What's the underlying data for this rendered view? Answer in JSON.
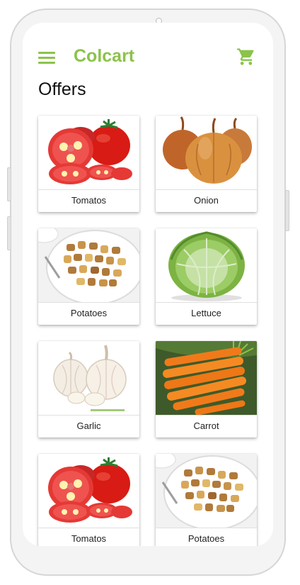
{
  "app": {
    "title": "Colcart"
  },
  "page": {
    "title": "Offers"
  },
  "icons": {
    "menu": "hamburger-menu-icon",
    "cart": "shopping-cart-icon"
  },
  "colors": {
    "brand": "#8bc34a"
  },
  "products": [
    {
      "name": "Tomatos",
      "image": "tomato"
    },
    {
      "name": "Onion",
      "image": "onion"
    },
    {
      "name": "Potatoes",
      "image": "potatoes"
    },
    {
      "name": "Lettuce",
      "image": "lettuce"
    },
    {
      "name": "Garlic",
      "image": "garlic"
    },
    {
      "name": "Carrot",
      "image": "carrot"
    },
    {
      "name": "Tomatos",
      "image": "tomato"
    },
    {
      "name": "Potatoes",
      "image": "potatoes"
    }
  ]
}
